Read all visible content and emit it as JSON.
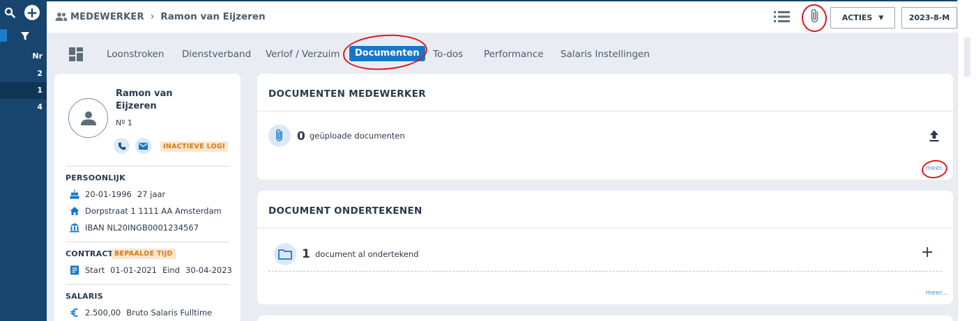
{
  "sidebar": {
    "nr_label": "Nr",
    "rows": [
      "2",
      "1",
      "4"
    ]
  },
  "header": {
    "breadcrumb_section": "MEDEWERKER",
    "breadcrumb_name": "Ramon van Eijzeren",
    "acties_label": "ACTIES",
    "period_label": "2023-8-M"
  },
  "tabs": [
    "Loonstroken",
    "Dienstverband",
    "Verlof / Verzuim",
    "Documenten",
    "To-dos",
    "Performance",
    "Salaris Instellingen"
  ],
  "active_tab": "Documenten",
  "profile": {
    "name_line1": "Ramon van",
    "name_line2": "Eijzeren",
    "number": "Nº 1",
    "status_badge": "INACTIEVE LOGI",
    "persoonlijk_title": "PERSOONLIJK",
    "birthdate": "20-01-1996",
    "age": "27 jaar",
    "address": "Dorpstraat 1 1111 AA Amsterdam",
    "iban": "IBAN NL20INGB0001234567",
    "contract_title": "CONTRACT",
    "contract_badge": "BEPAALDE TIJD",
    "start_label": "Start",
    "start_date": "01-01-2021",
    "end_label": "Eind",
    "end_date": "30-04-2023",
    "salaris_title": "SALARIS",
    "salary_amount": "2.500,00",
    "salary_desc": "Bruto Salaris Fulltime"
  },
  "documents_card": {
    "title": "DOCUMENTEN MEDEWERKER",
    "count": "0",
    "count_label": "geüploade documenten",
    "more_link": "meer..."
  },
  "sign_card": {
    "title": "DOCUMENT ONDERTEKENEN",
    "count": "1",
    "count_label": "document al ondertekend",
    "more_link": "meer..."
  },
  "colors": {
    "sidebar": "#17456e",
    "accent_blue": "#1677c8",
    "annotation_red": "#e2141c",
    "badge_orange": "#d47a1e"
  },
  "icons": [
    "search-icon",
    "plus-icon",
    "filter-icon",
    "people-icon",
    "list-view-icon",
    "paperclip-icon",
    "chevron-down-icon",
    "dashboard-grid-icon",
    "user-avatar-icon",
    "phone-icon",
    "mail-icon",
    "birthday-cake-icon",
    "home-icon",
    "bank-icon",
    "document-icon",
    "euro-icon",
    "upload-icon",
    "folder-icon",
    "add-icon"
  ]
}
